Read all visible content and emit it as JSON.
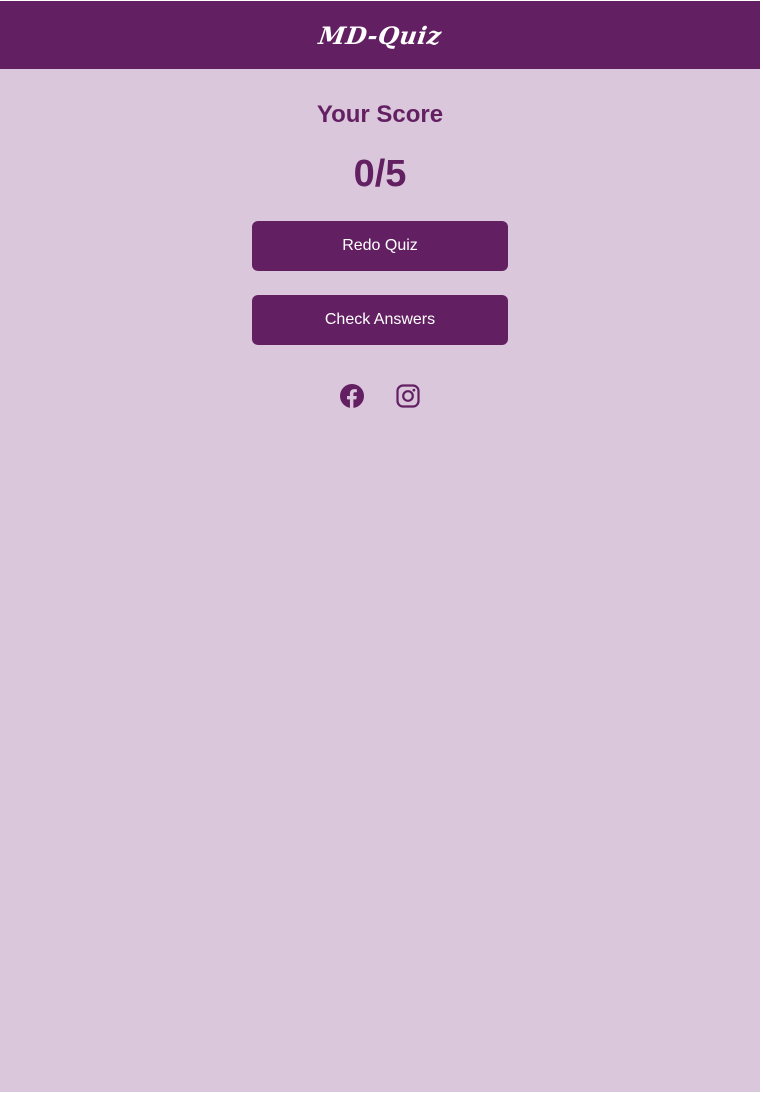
{
  "header": {
    "logo_text": "MD-Quiz"
  },
  "result": {
    "title": "Your Score",
    "score": "0/5"
  },
  "actions": {
    "redo_label": "Redo Quiz",
    "check_label": "Check Answers"
  },
  "socials": [
    {
      "icon": "facebook-icon"
    },
    {
      "icon": "instagram-icon"
    }
  ],
  "colors": {
    "brand": "#621f61",
    "background": "#dbc7dc",
    "button_text": "#ffffff"
  }
}
